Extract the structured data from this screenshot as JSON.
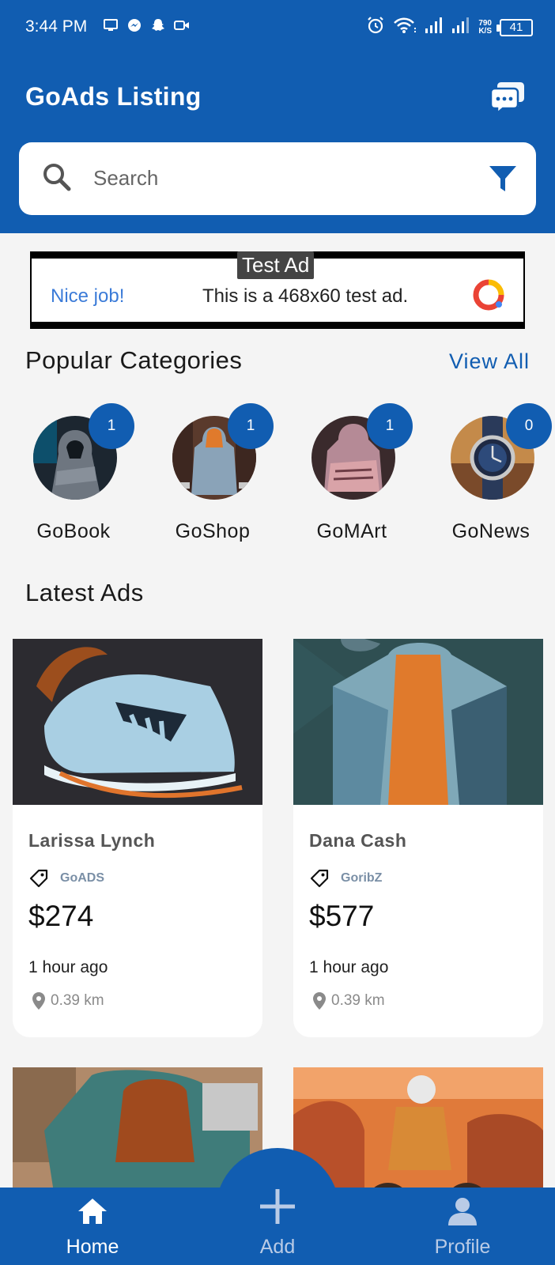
{
  "status_bar": {
    "time": "3:44 PM",
    "speed_value": "790",
    "speed_unit": "K/S",
    "battery": "41"
  },
  "header": {
    "title": "GoAds Listing",
    "chat_icon": "chat-bubbles-icon"
  },
  "search": {
    "placeholder": "Search",
    "filter_icon": "filter-icon"
  },
  "ad_banner": {
    "tag": "Test Ad",
    "nice": "Nice job!",
    "text": "This is a 468x60 test ad."
  },
  "categories": {
    "title": "Popular Categories",
    "view_all": "View All",
    "items": [
      {
        "label": "GoBook",
        "count": "1"
      },
      {
        "label": "GoShop",
        "count": "1"
      },
      {
        "label": "GoMArt",
        "count": "1"
      },
      {
        "label": "GoNews",
        "count": "0"
      }
    ]
  },
  "latest": {
    "title": "Latest Ads",
    "items": [
      {
        "title": "Larissa Lynch",
        "tag": "GoADS",
        "price": "$274",
        "time": "1 hour ago",
        "distance": "0.39 km"
      },
      {
        "title": "Dana Cash",
        "tag": "GoribZ",
        "price": "$577",
        "time": "1 hour ago",
        "distance": "0.39 km"
      }
    ]
  },
  "nav": {
    "home": "Home",
    "add": "Add",
    "profile": "Profile"
  },
  "colors": {
    "primary": "#115db1",
    "background": "#f4f4f4"
  }
}
